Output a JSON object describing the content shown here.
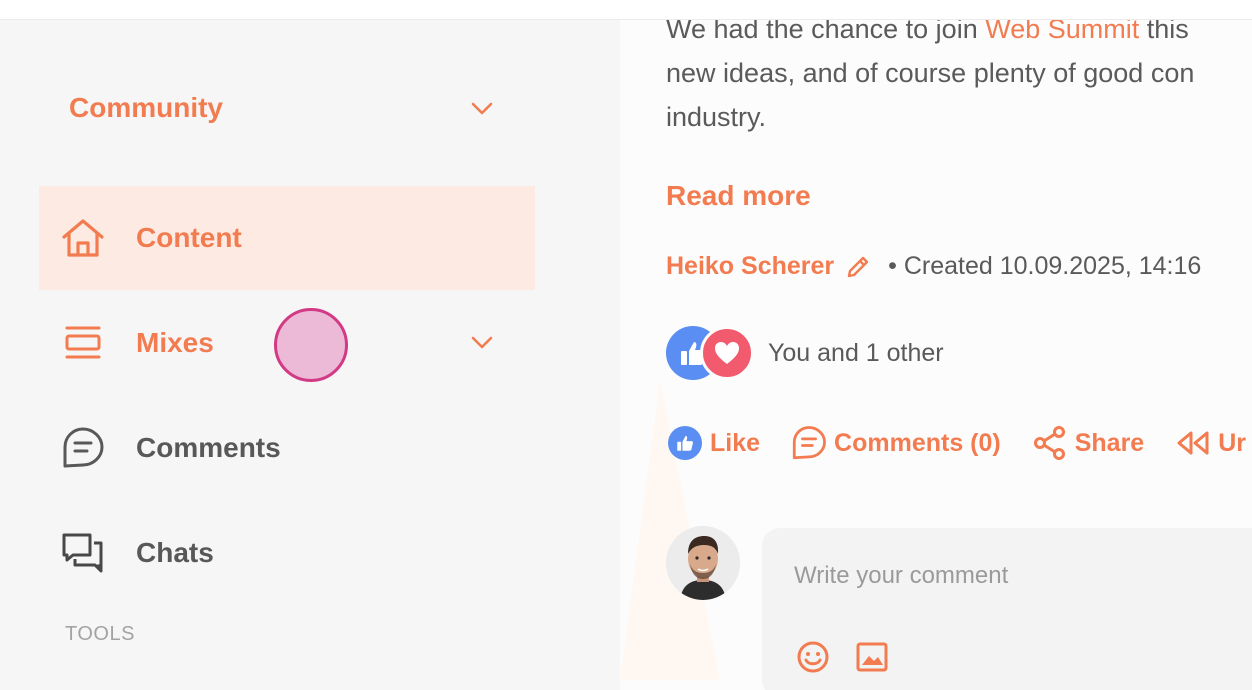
{
  "sidebar": {
    "community_label": "Community",
    "tools_heading": "TOOLS",
    "items": [
      {
        "label": "Content",
        "icon": "home-icon",
        "active": true
      },
      {
        "label": "Mixes",
        "icon": "layers-icon",
        "active": false
      },
      {
        "label": "Comments",
        "icon": "comment-icon",
        "active": false
      },
      {
        "label": "Chats",
        "icon": "chats-icon",
        "active": false
      }
    ]
  },
  "post": {
    "line1_prefix": "We had the chance to join ",
    "line1_link": "Web Summit",
    "line1_suffix": " this",
    "line2": "new ideas, and of course plenty of good con",
    "line3": "industry.",
    "read_more": "Read more",
    "author": "Heiko Scherer",
    "created": "• Created 10.09.2025, 14:16",
    "reactions_text": "You and 1 other",
    "actions": {
      "like": "Like",
      "comments": "Comments (0)",
      "share": "Share",
      "unfollow": "Ur"
    }
  },
  "comment": {
    "placeholder": "Write your comment"
  },
  "colors": {
    "accent": "#f27b50",
    "active_bg": "#fdebe3",
    "like_blue": "#5b8ef2",
    "love_red": "#f25a6e",
    "cursor": "#d33a85"
  }
}
